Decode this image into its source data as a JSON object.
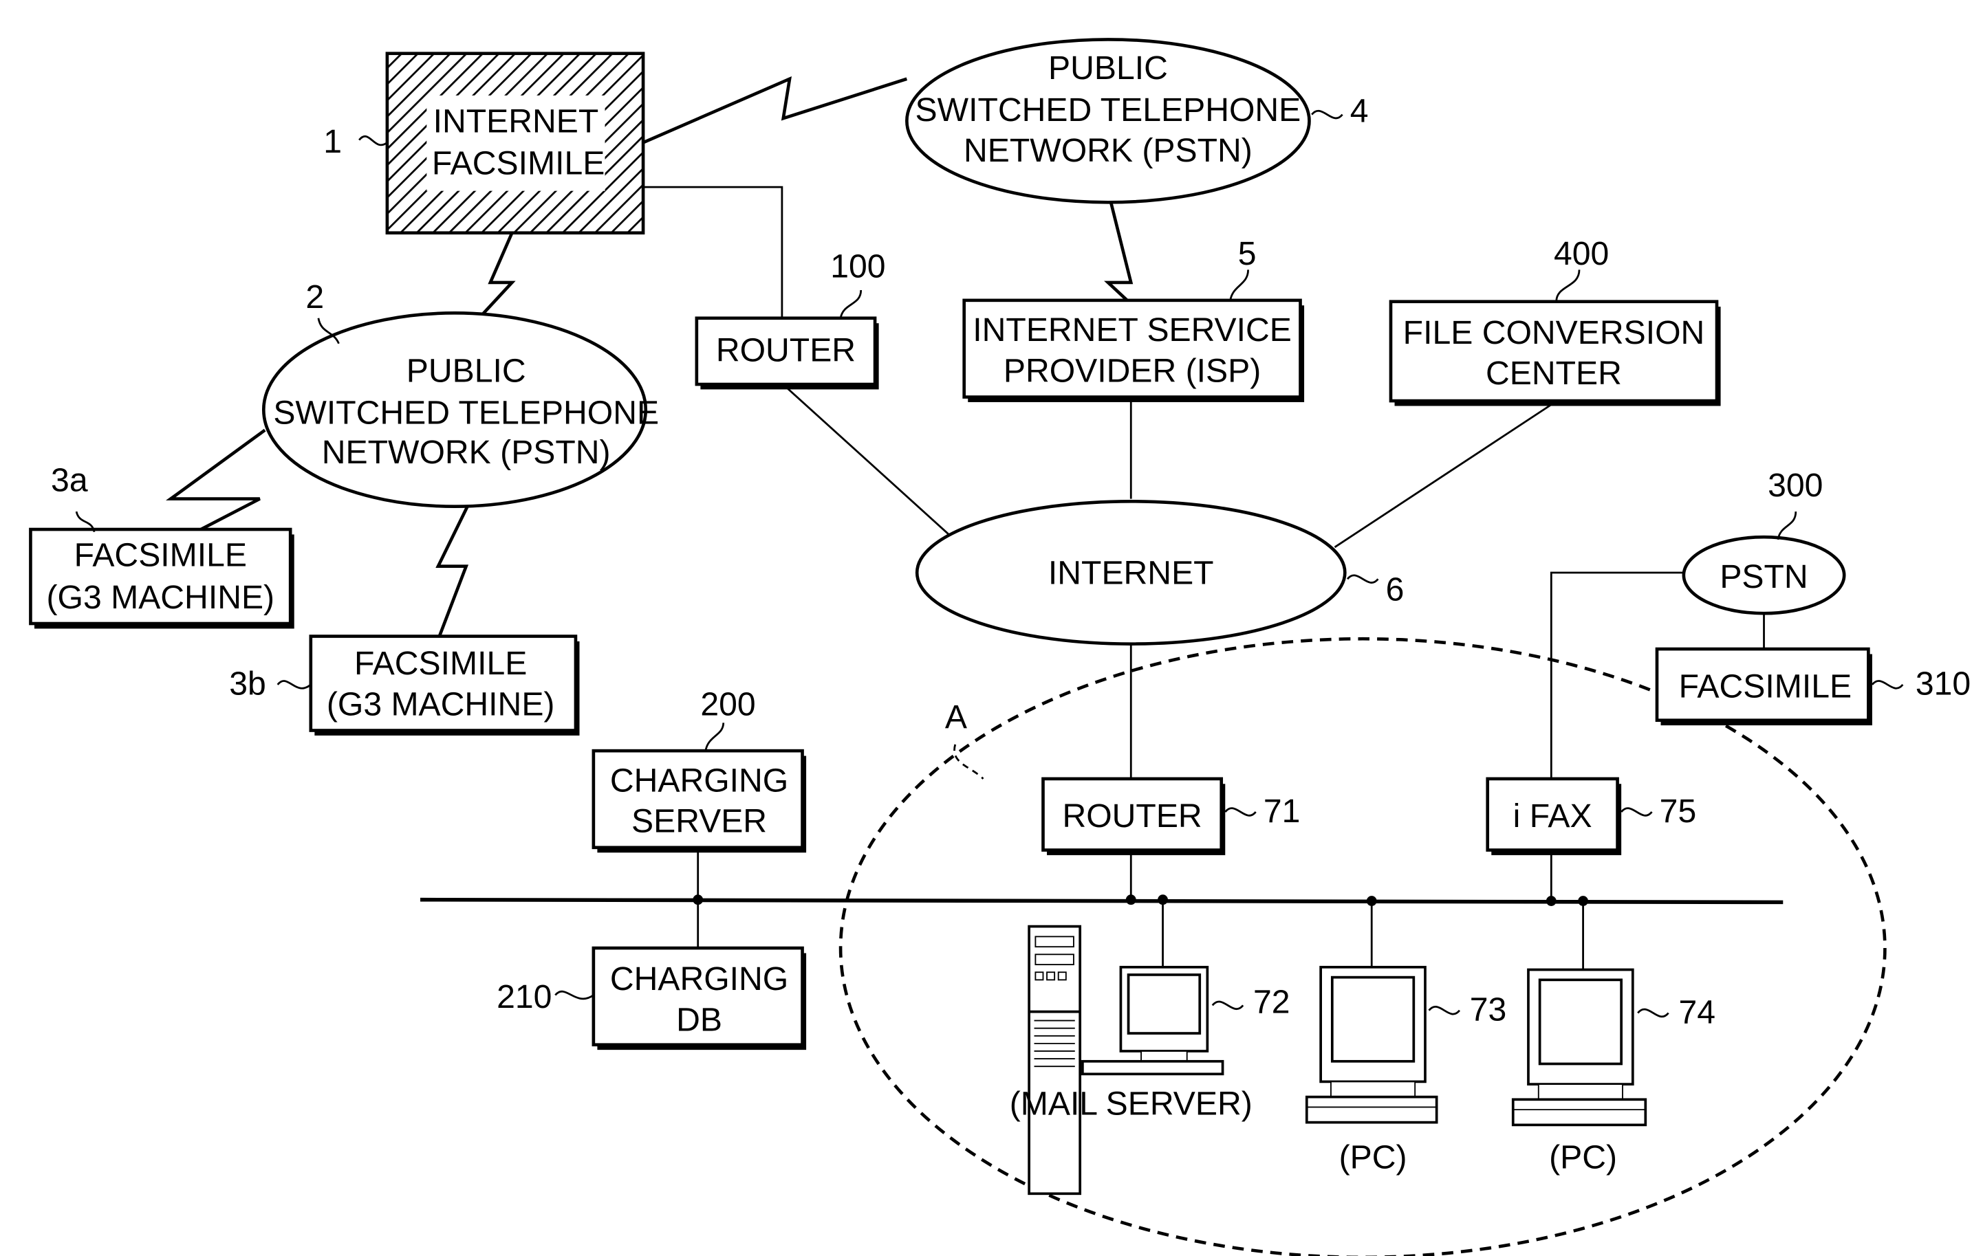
{
  "diagram": {
    "nodes": {
      "internet_fax": {
        "ref": "1",
        "lines": [
          "INTERNET",
          "FACSIMILE"
        ]
      },
      "pstn_2": {
        "ref": "2",
        "lines": [
          "PUBLIC",
          "SWITCHED TELEPHONE",
          "NETWORK (PSTN)"
        ]
      },
      "fax_3a": {
        "ref": "3a",
        "lines": [
          "FACSIMILE",
          "(G3 MACHINE)"
        ]
      },
      "fax_3b": {
        "ref": "3b",
        "lines": [
          "FACSIMILE",
          "(G3 MACHINE)"
        ]
      },
      "pstn_4": {
        "ref": "4",
        "lines": [
          "PUBLIC",
          "SWITCHED TELEPHONE",
          "NETWORK (PSTN)"
        ]
      },
      "isp": {
        "ref": "5",
        "lines": [
          "INTERNET SERVICE",
          "PROVIDER (ISP)"
        ]
      },
      "router_100": {
        "ref": "100",
        "lines": [
          "ROUTER"
        ]
      },
      "file_conversion": {
        "ref": "400",
        "lines": [
          "FILE CONVERSION",
          "CENTER"
        ]
      },
      "internet": {
        "ref": "6",
        "lines": [
          "INTERNET"
        ]
      },
      "pstn_300": {
        "ref": "300",
        "lines": [
          "PSTN"
        ]
      },
      "fax_310": {
        "ref": "310",
        "lines": [
          "FACSIMILE"
        ]
      },
      "charging_server": {
        "ref": "200",
        "lines": [
          "CHARGING",
          "SERVER"
        ]
      },
      "charging_db": {
        "ref": "210",
        "lines": [
          "CHARGING",
          "DB"
        ]
      },
      "router_71": {
        "ref": "71",
        "lines": [
          "ROUTER"
        ]
      },
      "ifax": {
        "ref": "75",
        "lines": [
          "i FAX"
        ]
      },
      "mail_server": {
        "ref": "72",
        "caption": "(MAIL SERVER)"
      },
      "pc_73": {
        "ref": "73",
        "caption": "(PC)"
      },
      "pc_74": {
        "ref": "74",
        "caption": "(PC)"
      },
      "lan_area": {
        "ref": "A"
      }
    }
  }
}
